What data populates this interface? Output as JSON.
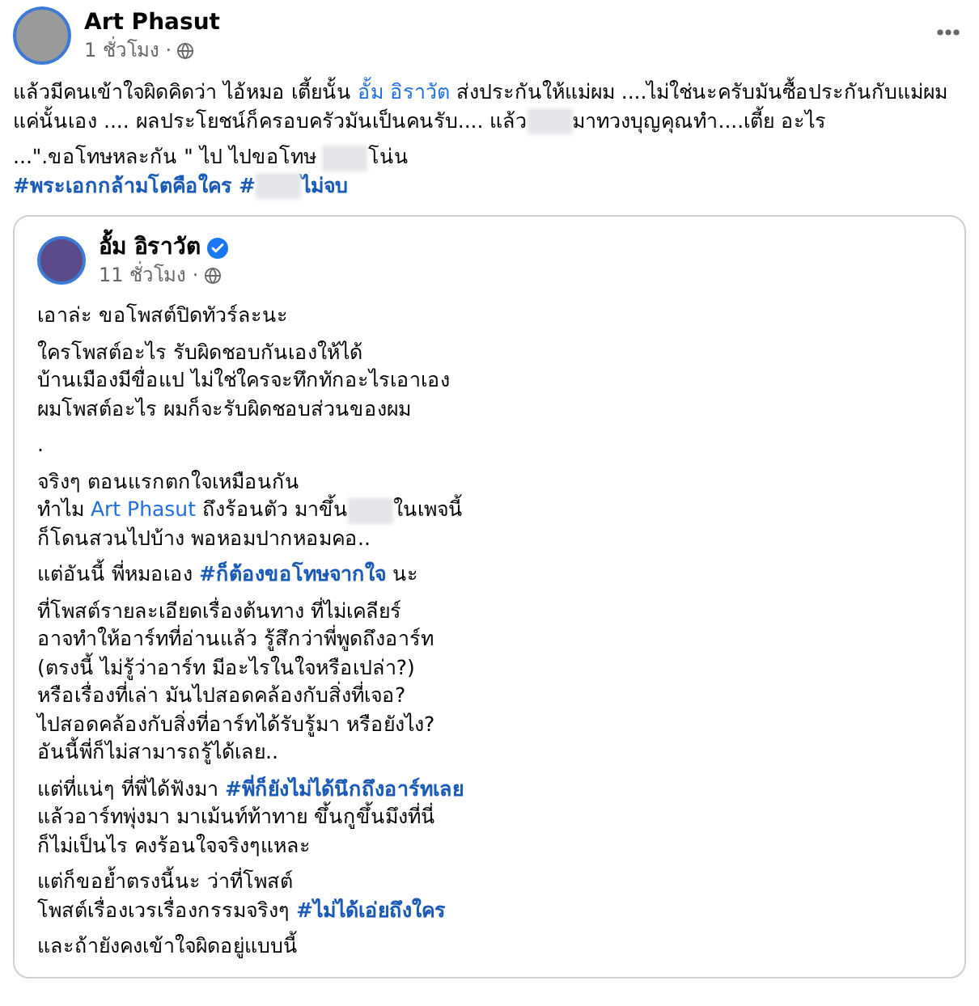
{
  "post": {
    "author": "Art Phasut",
    "time": "1 ชั่วโมง ·",
    "paragraphs": [
      {
        "lines": [
          [
            {
              "kind": "text",
              "text": "แล้วมีคนเข้าใจผิดคิดว่า ไอ้หมอ เตี้ยนั้น "
            },
            {
              "kind": "link",
              "text": "อั้ม อิราวัต"
            },
            {
              "kind": "text",
              "text": "  ส่งประกันให้แม่ผม ....ไม่ใช่นะครับมันซื้อประกันกับแม่ผม"
            }
          ],
          [
            {
              "kind": "text",
              "text": "แค่นั้นเอง .... ผลประโยชน์ก็ครอบครัวมันเป็นคนรับ.... แล้ว"
            },
            {
              "kind": "redacted"
            },
            {
              "kind": "text",
              "text": "มาทวงบุญคุณทำ....เตี้ย อะไร"
            }
          ]
        ]
      },
      {
        "lines": [
          [
            {
              "kind": "text",
              "text": "...\".ขอโทษหละกัน \" ไป ไปขอโทษ "
            },
            {
              "kind": "redacted"
            },
            {
              "kind": "text",
              "text": "โน่น"
            }
          ],
          [
            {
              "kind": "hashtag",
              "text": "#พระเอกกล้ามโตคือใคร"
            },
            {
              "kind": "hashtag",
              "text": "#"
            },
            {
              "kind": "redacted"
            },
            {
              "kind": "hashtag",
              "text": "ไม่จบ"
            }
          ]
        ]
      }
    ]
  },
  "shared_post": {
    "author": "อั้ม อิราวัต",
    "verified": true,
    "time": "11 ชั่วโมง ·",
    "paragraphs": [
      {
        "lines": [
          [
            {
              "kind": "text",
              "text": "เอาล่ะ ขอโพสต์ปิดทัวร์ละนะ"
            }
          ]
        ]
      },
      {
        "lines": [
          [
            {
              "kind": "text",
              "text": "ใครโพสต์อะไร รับผิดชอบกันเองให้ได้"
            }
          ],
          [
            {
              "kind": "text",
              "text": "บ้านเมืองมีขื่อแป ไม่ใช่ใครจะทึกทักอะไรเอาเอง"
            }
          ],
          [
            {
              "kind": "text",
              "text": "ผมโพสต์อะไร ผมก็จะรับผิดชอบส่วนของผม"
            }
          ]
        ]
      },
      {
        "lines": [
          [
            {
              "kind": "text",
              "text": "."
            }
          ]
        ]
      },
      {
        "lines": [
          [
            {
              "kind": "text",
              "text": "จริงๆ ตอนแรกตกใจเหมือนกัน"
            }
          ],
          [
            {
              "kind": "text",
              "text": "ทำไม "
            },
            {
              "kind": "link",
              "text": "Art Phasut"
            },
            {
              "kind": "text",
              "text": " ถึงร้อนตัว มาขึ้น"
            },
            {
              "kind": "redacted"
            },
            {
              "kind": "text",
              "text": "ในเพจนี้"
            }
          ],
          [
            {
              "kind": "text",
              "text": "ก็โดนสวนไปบ้าง พอหอมปากหอมคอ.."
            }
          ]
        ]
      },
      {
        "lines": [
          [
            {
              "kind": "text",
              "text": "แต่อันนี้ พี่หมอเอง "
            },
            {
              "kind": "hashtag",
              "text": "#ก็ต้องขอโทษจากใจ"
            },
            {
              "kind": "text",
              "text": " นะ"
            }
          ]
        ]
      },
      {
        "lines": [
          [
            {
              "kind": "text",
              "text": "ที่โพสต์รายละเอียดเรื่องต้นทาง ที่ไม่เคลียร์"
            }
          ],
          [
            {
              "kind": "text",
              "text": "อาจทำให้อาร์ทที่อ่านแล้ว รู้สึกว่าพี่พูดถึงอาร์ท"
            }
          ],
          [
            {
              "kind": "text",
              "text": "(ตรงนี้ ไม่รู้ว่าอาร์ท มีอะไรในใจหรือเปล่า?)"
            }
          ],
          [
            {
              "kind": "text",
              "text": "หรือเรื่องที่เล่า มันไปสอดคล้องกับสิ่งที่เจอ?"
            }
          ],
          [
            {
              "kind": "text",
              "text": "ไปสอดคล้องกับสิ่งที่อาร์ทได้รับรู้มา หรือยังไง?"
            }
          ],
          [
            {
              "kind": "text",
              "text": "อันนี้พี่ก็ไม่สามารถรู้ได้เลย.."
            }
          ]
        ]
      },
      {
        "lines": [
          [
            {
              "kind": "text",
              "text": "แต่ที่แน่ๆ ที่พี่ได้ฟังมา "
            },
            {
              "kind": "hashtag",
              "text": "#พี่ก็ยังไม่ได้นึกถึงอาร์ทเลย"
            }
          ],
          [
            {
              "kind": "text",
              "text": "แล้วอาร์ทพุ่งมา มาเม้นท์ท้าทาย ขึ้นกูขึ้นมึงที่นี่"
            }
          ],
          [
            {
              "kind": "text",
              "text": "ก็ไม่เป็นไร คงร้อนใจจริงๆแหละ"
            }
          ]
        ]
      },
      {
        "lines": [
          [
            {
              "kind": "text",
              "text": "แต่ก็ขอย้ำตรงนี้นะ ว่าที่โพสต์"
            }
          ],
          [
            {
              "kind": "text",
              "text": "โพสต์เรื่องเวรเรื่องกรรมจริงๆ "
            },
            {
              "kind": "hashtag",
              "text": "#ไม่ได้เอ่ยถึงใคร"
            }
          ]
        ]
      },
      {
        "lines": [
          [
            {
              "kind": "text",
              "text": "และถ้ายังคงเข้าใจผิดอยู่แบบนี้"
            }
          ]
        ]
      }
    ]
  }
}
